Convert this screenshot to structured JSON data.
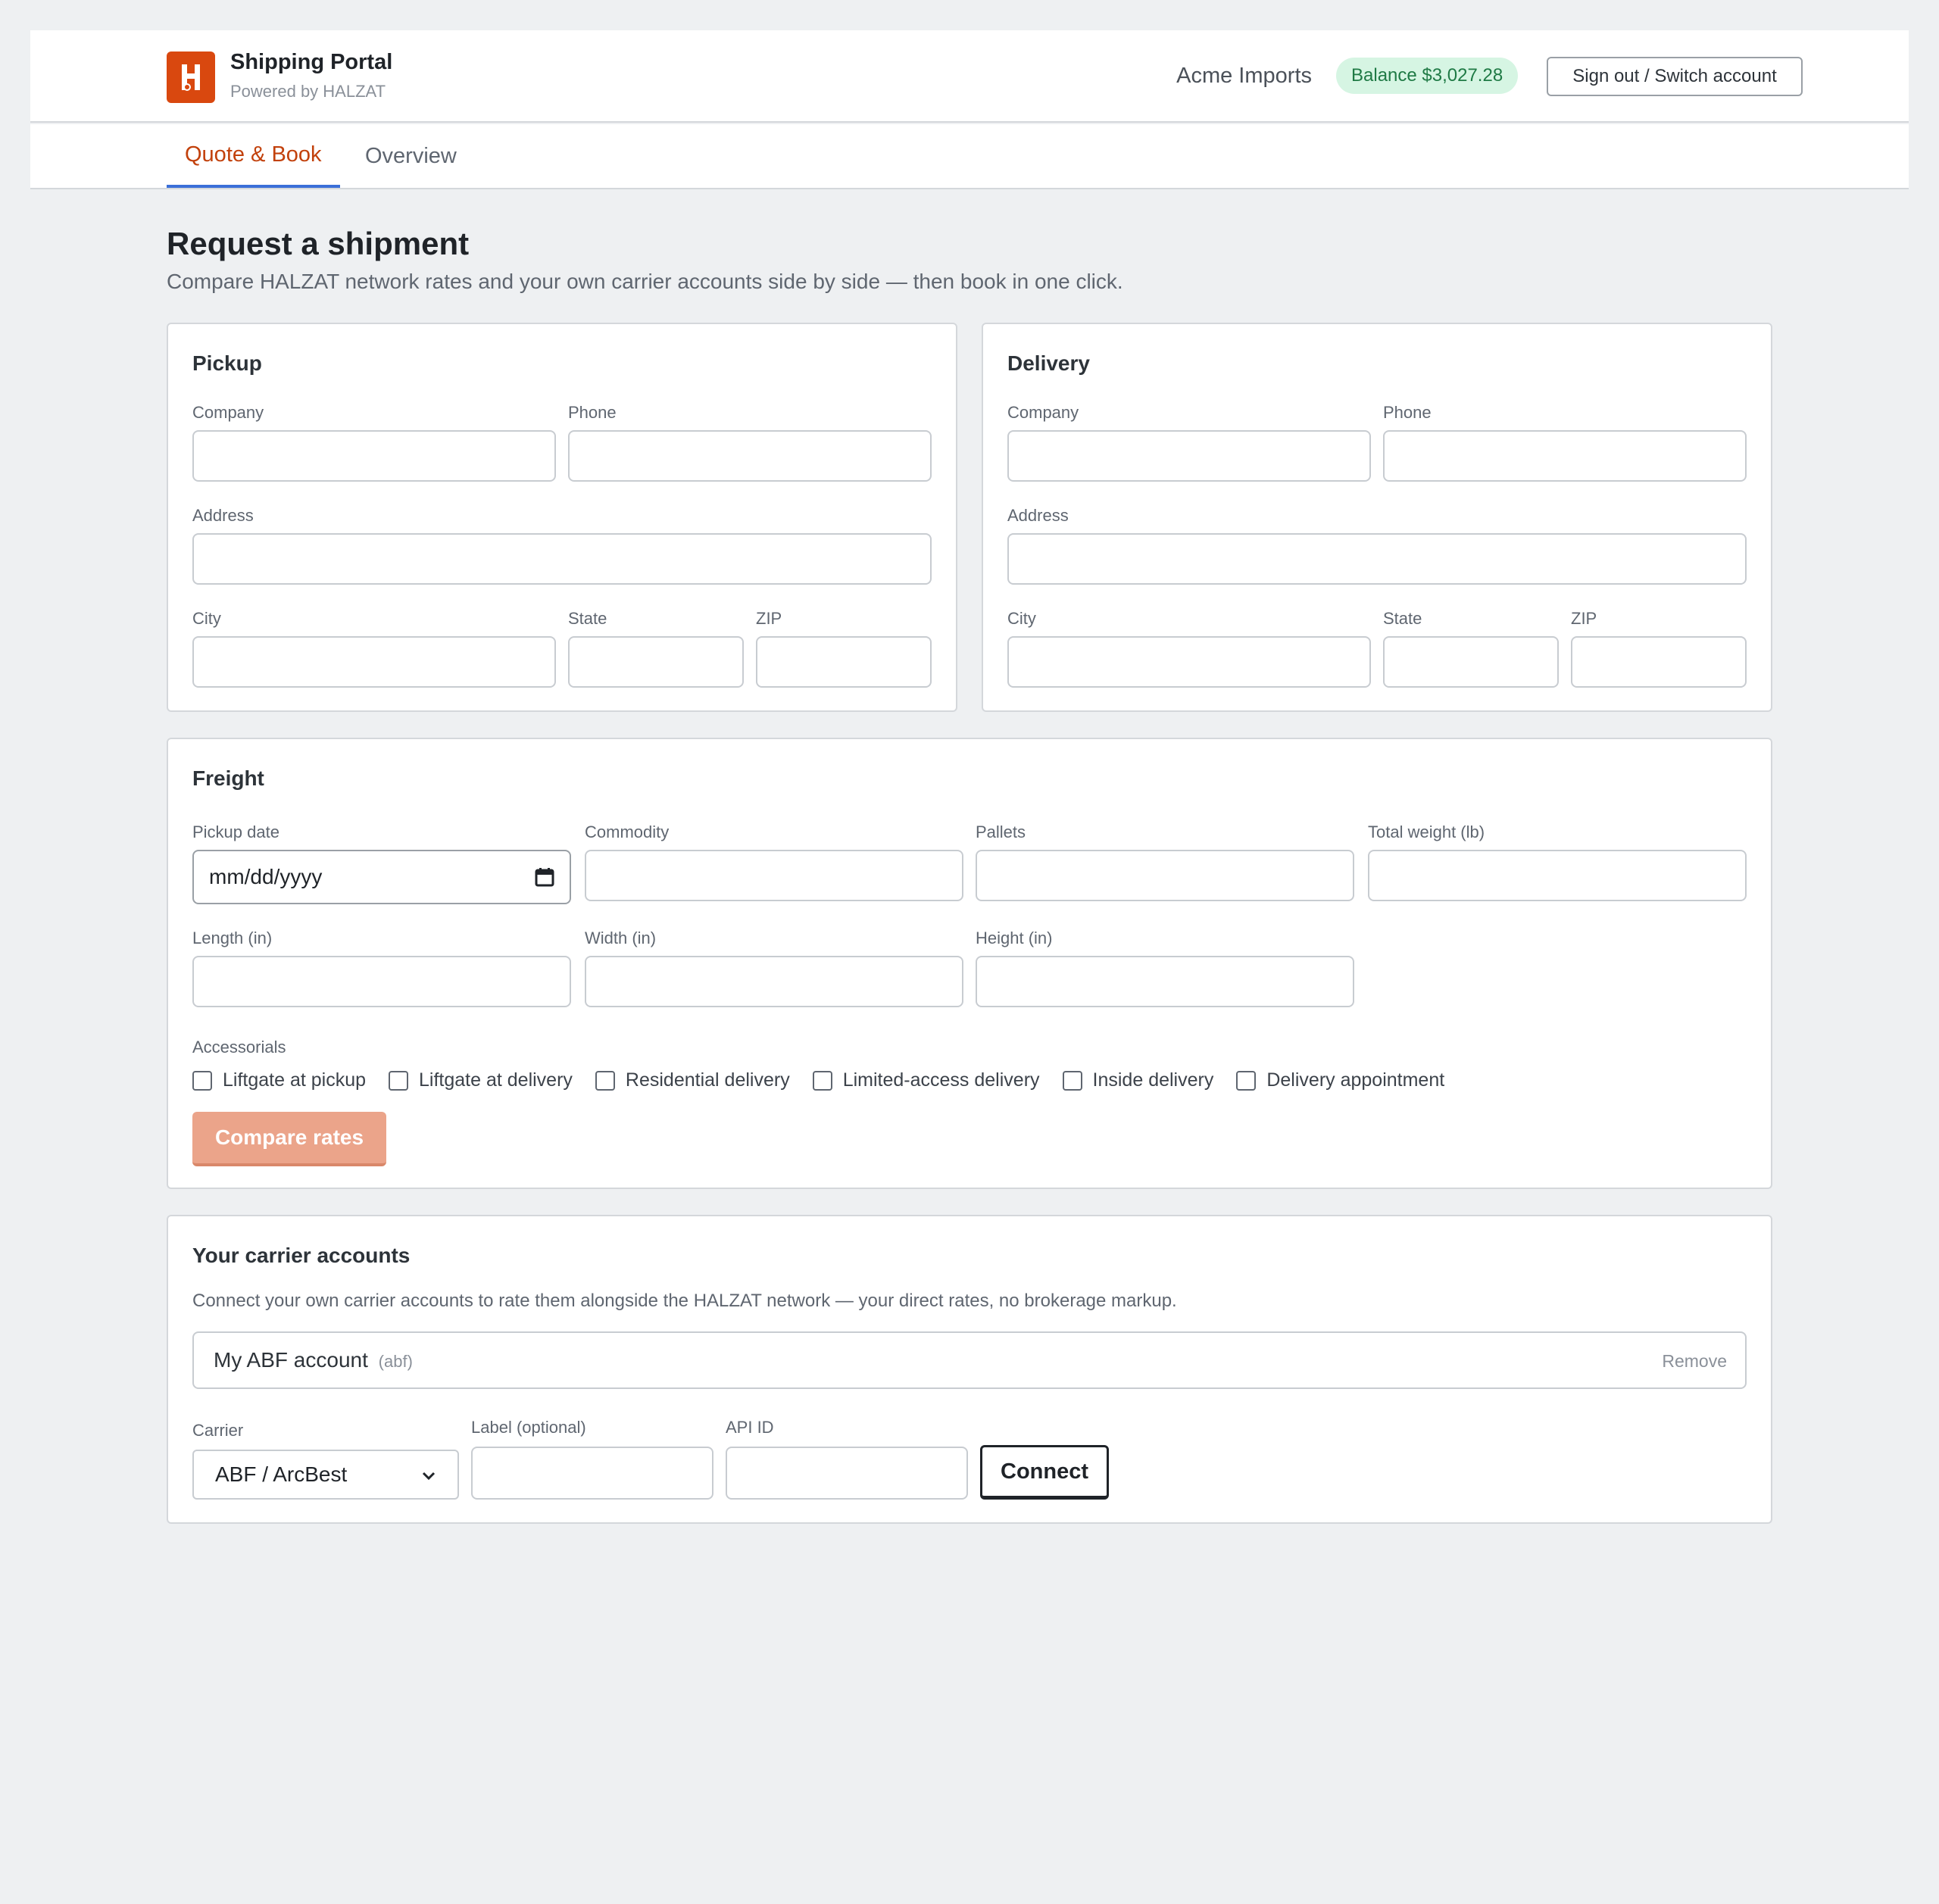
{
  "header": {
    "app_title": "Shipping Portal",
    "powered_by": "Powered by HALZAT",
    "account_name": "Acme Imports",
    "balance": "Balance $3,027.28",
    "signout_label": "Sign out / Switch account",
    "logo_letter": "H",
    "brand_color": "#d9480f",
    "balance_bg": "#d6f5e3",
    "balance_fg": "#1f7a45"
  },
  "tabs": [
    {
      "label": "Quote & Book",
      "active": true
    },
    {
      "label": "Overview",
      "active": false
    }
  ],
  "page": {
    "title": "Request a shipment",
    "subtitle": "Compare HALZAT network rates and your own carrier accounts side by side — then book in one click."
  },
  "pickup": {
    "title": "Pickup",
    "company_label": "Company",
    "phone_label": "Phone",
    "address_label": "Address",
    "city_label": "City",
    "state_label": "State",
    "zip_label": "ZIP"
  },
  "delivery": {
    "title": "Delivery",
    "company_label": "Company",
    "phone_label": "Phone",
    "address_label": "Address",
    "city_label": "City",
    "state_label": "State",
    "zip_label": "ZIP"
  },
  "freight": {
    "title": "Freight",
    "pickup_date_label": "Pickup date",
    "pickup_date_placeholder": "mm/dd/yyyy",
    "commodity_label": "Commodity",
    "pallets_label": "Pallets",
    "weight_label": "Total weight (lb)",
    "length_label": "Length (in)",
    "width_label": "Width (in)",
    "height_label": "Height (in)",
    "accessorials_label": "Accessorials",
    "accessorials": [
      "Liftgate at pickup",
      "Liftgate at delivery",
      "Residential delivery",
      "Limited-access delivery",
      "Inside delivery",
      "Delivery appointment"
    ],
    "compare_label": "Compare rates"
  },
  "carrier_accounts": {
    "title": "Your carrier accounts",
    "description": "Connect your own carrier accounts to rate them alongside the HALZAT network — your direct rates, no brokerage markup.",
    "accounts": [
      {
        "name": "My ABF account",
        "code": "(abf)",
        "remove_label": "Remove"
      }
    ],
    "carrier_label": "Carrier",
    "carrier_selected": "ABF / ArcBest",
    "label_label": "Label (optional)",
    "api_id_label": "API ID",
    "connect_label": "Connect"
  }
}
